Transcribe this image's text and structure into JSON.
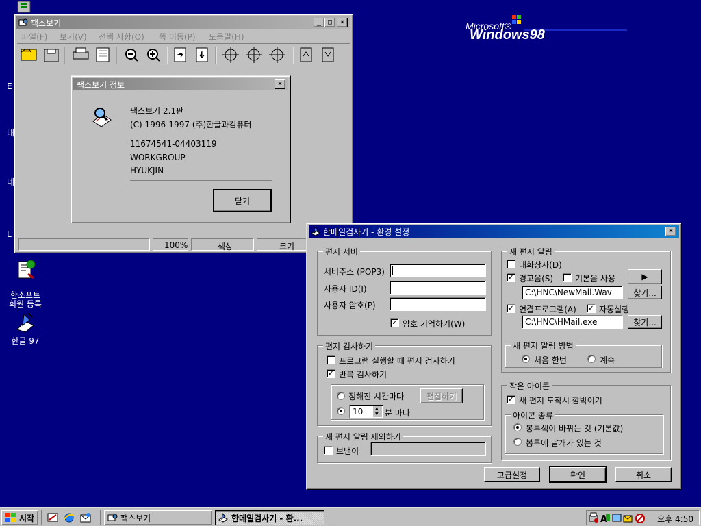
{
  "desktop": {
    "logo_microsoft": "Microsoft®",
    "logo_windows": "Windows98",
    "icons": [
      {
        "label": "한소프트\n회원 등록"
      },
      {
        "label": "한글 97"
      }
    ]
  },
  "fax_viewer": {
    "title": "팩스보기",
    "menu": [
      "파일(F)",
      "보기(V)",
      "선택 사항(O)",
      "쪽 이동(P)",
      "도움말(H)"
    ],
    "status": {
      "zoom": "100%",
      "color": "색상",
      "size": "크기"
    }
  },
  "about_dialog": {
    "title": "팩스보기 정보",
    "product": "팩스보기 2.1판",
    "copyright": "(C) 1996-1997 (주)한글과컴퓨터",
    "serial": "11674541-04403119",
    "org": "WORKGROUP",
    "user": "HYUKJIN",
    "close_label": "닫기"
  },
  "settings_dialog": {
    "title": "한메일검사기 - 환경 설정",
    "server": {
      "legend": "편지 서버",
      "address_label": "서버주소 (POP3)",
      "address_value": "",
      "id_label": "사용자 ID(I)",
      "id_value": "",
      "password_label": "사용자 암호(P)",
      "password_value": "",
      "remember_label": "암호 기억하기(W)",
      "remember_checked": true
    },
    "check": {
      "legend": "편지 검사하기",
      "on_start_label": "프로그램 실행할 때 편지 검사하기",
      "on_start_checked": false,
      "repeat_label": "반복 검사하기",
      "repeat_checked": true,
      "scheduled_label": "정해진 시간마다",
      "edit_label": "편집하기",
      "interval_value": "10",
      "interval_unit": "분 마다"
    },
    "exclude": {
      "legend": "새 편지 알림 제외하기",
      "sender_label": "보낸이",
      "sender_checked": false,
      "sender_value": ""
    },
    "notify": {
      "legend": "새 편지 알림",
      "dialog_label": "대화상자(D)",
      "dialog_checked": false,
      "sound_label": "경고음(S)",
      "sound_checked": true,
      "default_sound_label": "기본음 사용",
      "default_sound_checked": false,
      "sound_path": "C:\\HNC\\NewMail.Wav",
      "browse_label": "찾기...",
      "app_label": "연결프로그램(A)",
      "app_checked": true,
      "autorun_label": "자동실행",
      "autorun_checked": true,
      "app_path": "C:\\HNC\\HMail.exe",
      "browse2_label": "찾기...",
      "play_symbol": "▶"
    },
    "method": {
      "legend": "새 편지 알림 방법",
      "once_label": "처음 한번",
      "continuous_label": "계속",
      "selected": "once"
    },
    "small_icon": {
      "legend": "작은 아이콘",
      "blink_label": "새 편지 도착시 깜박이기",
      "blink_checked": true,
      "kind_legend": "아이콘 종류",
      "kind1_label": "봉투색이 바뀌는 것 (기본값)",
      "kind2_label": "봉투에 날개가 있는 것",
      "selected": "kind1"
    },
    "buttons": {
      "advanced": "고급설정",
      "ok": "확인",
      "cancel": "취소"
    }
  },
  "taskbar": {
    "start_label": "시작",
    "tasks": [
      "팩스보기",
      "한메일검사기 - 환..."
    ],
    "clock": "오후 4:50"
  },
  "colors": {
    "desktop": "#000080",
    "titlebar_active": "#000080",
    "titlebar_inactive": "#808080",
    "face": "#c0c0c0"
  }
}
